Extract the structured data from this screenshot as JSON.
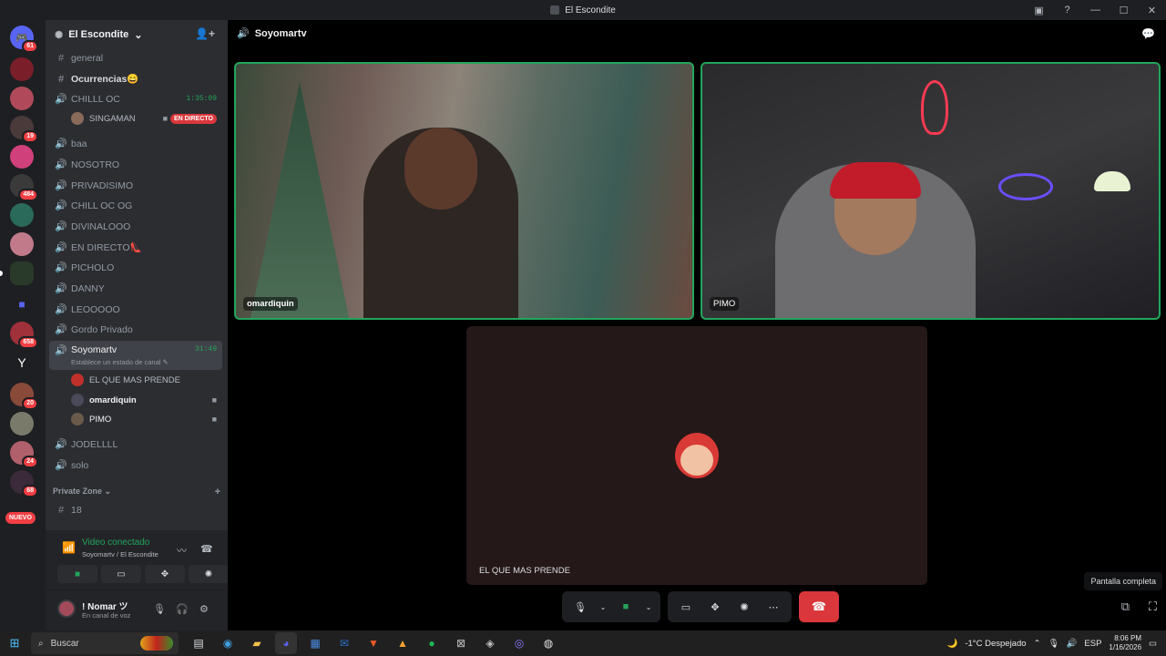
{
  "window": {
    "title": "El Escondite",
    "icons": [
      "minimize-icon",
      "maximize-icon",
      "close-icon"
    ]
  },
  "servers": {
    "badges": [
      "61",
      "19",
      "484",
      "658",
      "20",
      "24",
      "68"
    ],
    "nuevo_label": "NUEVO"
  },
  "guild": {
    "name": "El Escondite"
  },
  "channels": {
    "items": [
      {
        "type": "text",
        "name": "general"
      },
      {
        "type": "text",
        "name": "Ocurrencias😄"
      },
      {
        "type": "voice",
        "name": "CHILLL OC",
        "time": "1:35:09"
      },
      {
        "type": "voice",
        "name": "baa"
      },
      {
        "type": "voice",
        "name": "NOSOTRO"
      },
      {
        "type": "voice",
        "name": "PRIVADISIMO"
      },
      {
        "type": "voice",
        "name": "CHILL OC OG"
      },
      {
        "type": "voice",
        "name": "DIVINALOOO"
      },
      {
        "type": "voice",
        "name": "EN DIRECTO👠"
      },
      {
        "type": "voice",
        "name": "PICHOLO"
      },
      {
        "type": "voice",
        "name": "DANNY"
      },
      {
        "type": "voice",
        "name": "LEOOOOO"
      },
      {
        "type": "voice",
        "name": "Gordo Privado"
      },
      {
        "type": "voice",
        "name": "Soyomartv",
        "time": "31:49",
        "status": "Establece un estado de canal"
      },
      {
        "type": "voice",
        "name": "JODELLLL"
      },
      {
        "type": "voice",
        "name": "solo"
      }
    ],
    "chilll_member": {
      "name": "SINGAMAN",
      "live": "EN DIRECTO"
    },
    "soyomartv_members": [
      {
        "name": "EL QUE MAS PRENDE"
      },
      {
        "name": "omardiquin"
      },
      {
        "name": "PIMO"
      }
    ],
    "category": "Private Zone",
    "private_channel": "18"
  },
  "voice_panel": {
    "title": "Video conectado",
    "sub": "Soyomartv / El Escondite"
  },
  "user_panel": {
    "name": "! Nomar ツ",
    "status": "En canal de voz"
  },
  "stage": {
    "channel": "Soyomartv",
    "tiles": [
      {
        "name": "omardiquin"
      },
      {
        "name": "PIMO"
      },
      {
        "name": "EL QUE MAS PRENDE"
      }
    ],
    "tooltip": "Pantalla completa"
  },
  "taskbar": {
    "search_placeholder": "Buscar",
    "weather": "-1°C  Despejado",
    "lang": "ESP",
    "time": "8:06 PM",
    "date": "1/16/2026"
  },
  "colors": {
    "accent_green": "#23a55a",
    "danger": "#da373c",
    "bg": "#2b2d31"
  }
}
